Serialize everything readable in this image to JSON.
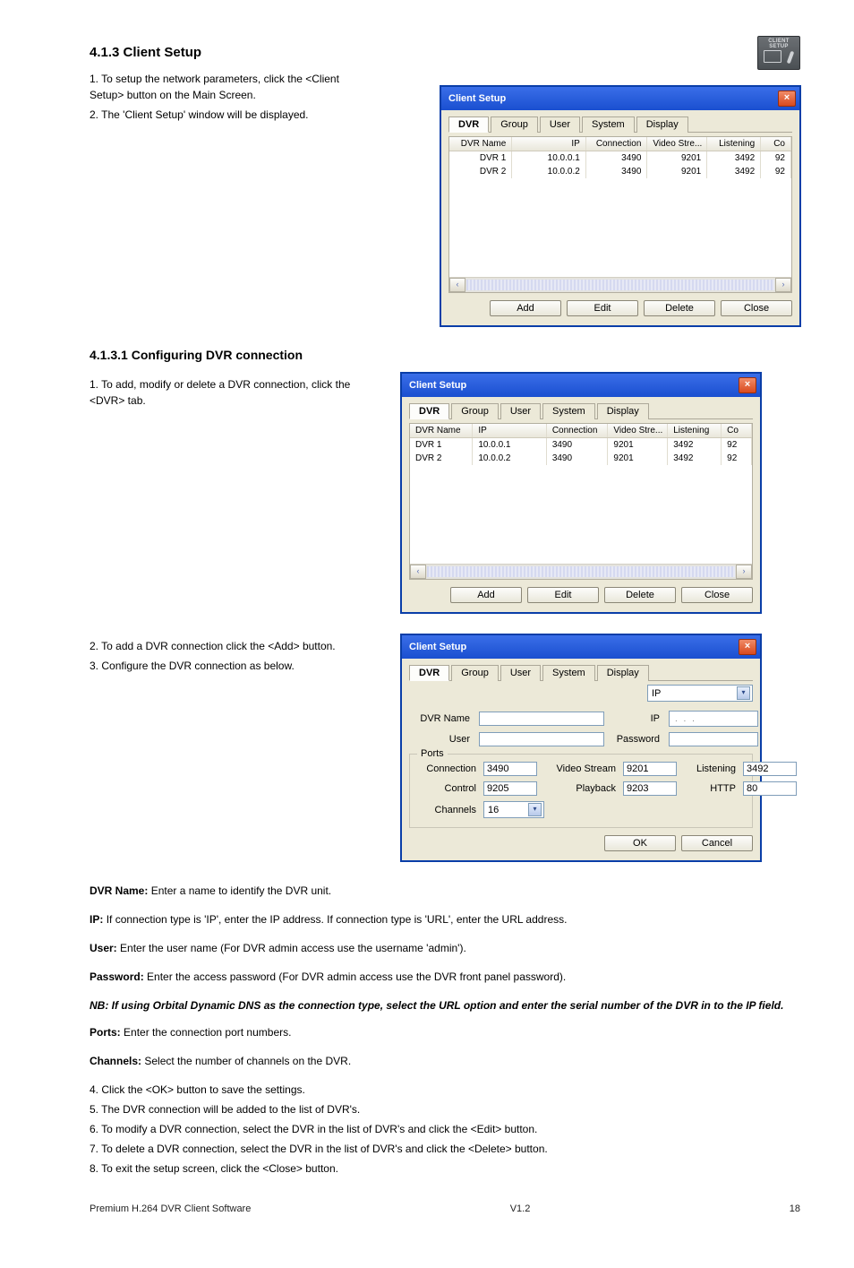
{
  "section1": {
    "heading": "4.1.3 Client Setup",
    "icon_label": "CLIENT SETUP",
    "step1_num": "1.",
    "step1_text": "To setup the network parameters, click the <Client Setup> button on the Main Screen.",
    "step2_num": "2.",
    "step2_text": "The 'Client Setup' window will be displayed."
  },
  "dialog_common": {
    "title": "Client Setup",
    "tabs": {
      "dvr": "DVR",
      "group": "Group",
      "user": "User",
      "system": "System",
      "display": "Display"
    },
    "columns": {
      "name": "DVR Name",
      "ip": "IP",
      "conn": "Connection",
      "vs": "Video Stre...",
      "lis": "Listening",
      "co": "Co"
    },
    "rows": [
      {
        "name": "DVR 1",
        "ip": "10.0.0.1",
        "conn": "3490",
        "vs": "9201",
        "lis": "3492",
        "co": "92"
      },
      {
        "name": "DVR 2",
        "ip": "10.0.0.2",
        "conn": "3490",
        "vs": "9201",
        "lis": "3492",
        "co": "92"
      }
    ],
    "buttons": {
      "add": "Add",
      "edit": "Edit",
      "delete": "Delete",
      "close": "Close"
    }
  },
  "section2": {
    "heading": "4.1.3.1 Configuring DVR connection",
    "step1_num": "1.",
    "step1_text": "To add, modify or delete a DVR connection, click the <DVR> tab.",
    "step2_num": "2.",
    "step2_text": "To add a DVR connection click the <Add> button.",
    "step3_num": "3.",
    "step3_text": "Configure the DVR connection as below."
  },
  "form_dialog": {
    "type_label": "IP",
    "labels": {
      "dvr_name": "DVR Name",
      "ip": "IP",
      "user": "User",
      "password": "Password",
      "ports": "Ports",
      "connection": "Connection",
      "video_stream": "Video Stream",
      "listening": "Listening",
      "control": "Control",
      "playback": "Playback",
      "http": "HTTP",
      "channels": "Channels"
    },
    "values": {
      "connection": "3490",
      "video_stream": "9201",
      "listening": "3492",
      "control": "9205",
      "playback": "9203",
      "http": "80",
      "channels": "16"
    },
    "ip_dots": ".   .   .",
    "buttons": {
      "ok": "OK",
      "cancel": "Cancel"
    }
  },
  "definitions": [
    {
      "label": "DVR Name:",
      "text": "Enter a name to identify the DVR unit."
    },
    {
      "label": "IP:",
      "text": "If connection type is 'IP', enter the IP address. If connection type is 'URL', enter the URL address."
    },
    {
      "label": "User:",
      "text": "Enter the user name (For DVR admin access use the username 'admin')."
    },
    {
      "label": "Password:",
      "text": "Enter the access password (For DVR admin access use the DVR front panel password)."
    }
  ],
  "note": "NB: If using Orbital Dynamic DNS as the connection type, select the URL option and enter the serial number of the DVR in to the IP field.",
  "portsdefs": [
    {
      "label": "Ports:",
      "text": "Enter the connection port numbers."
    },
    {
      "label": "Channels:",
      "text": "Select the number of channels on the DVR."
    }
  ],
  "closing": {
    "step4_num": "4.",
    "step4_text": "Click the <OK> button to save the settings.",
    "step5_num": "5.",
    "step5_text": "The DVR connection will be added to the list of DVR's.",
    "step6_num": "6.",
    "step6_text": "To modify a DVR connection, select the DVR in the list of DVR's and click the <Edit> button.",
    "step7_num": "7.",
    "step7_text": "To delete a DVR connection, select the DVR in the list of DVR's and click the <Delete> button.",
    "step8_num": "8.",
    "step8_text": "To exit the setup screen, click the <Close> button."
  },
  "footer": {
    "doc": "Premium H.264 DVR Client Software",
    "ver": "V1.2",
    "page": "18"
  }
}
